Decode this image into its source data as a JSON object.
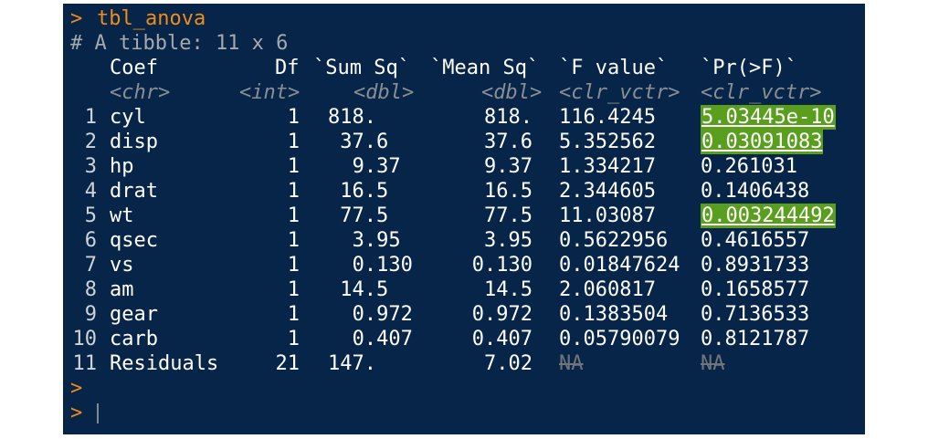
{
  "console": {
    "prompt_symbol": ">",
    "command": "tbl_anova",
    "tibble_header": "# A tibble: 11 x 6",
    "columns": [
      {
        "name": "Coef",
        "type": "<chr>"
      },
      {
        "name": "Df",
        "type": "<int>"
      },
      {
        "name": "`Sum Sq`",
        "type": "<dbl>"
      },
      {
        "name": "`Mean Sq`",
        "type": "<dbl>"
      },
      {
        "name": "`F value`",
        "type": "<clr_vctr>"
      },
      {
        "name": "`Pr(>F)`",
        "type": "<clr_vctr>"
      }
    ],
    "rows": [
      {
        "num": "1",
        "coef": "cyl",
        "df": "1",
        "sum_sq": "818.",
        "mean_sq": "818.",
        "f_value": "116.4245",
        "p_value": "5.03445e-10",
        "significant": true
      },
      {
        "num": "2",
        "coef": "disp",
        "df": "1",
        "sum_sq": "37.6",
        "mean_sq": "37.6",
        "f_value": "5.352562",
        "p_value": "0.03091083",
        "significant": true
      },
      {
        "num": "3",
        "coef": "hp",
        "df": "1",
        "sum_sq": "9.37",
        "mean_sq": "9.37",
        "f_value": "1.334217",
        "p_value": "0.261031",
        "significant": false
      },
      {
        "num": "4",
        "coef": "drat",
        "df": "1",
        "sum_sq": "16.5",
        "mean_sq": "16.5",
        "f_value": "2.344605",
        "p_value": "0.1406438",
        "significant": false
      },
      {
        "num": "5",
        "coef": "wt",
        "df": "1",
        "sum_sq": "77.5",
        "mean_sq": "77.5",
        "f_value": "11.03087",
        "p_value": "0.003244492",
        "significant": true
      },
      {
        "num": "6",
        "coef": "qsec",
        "df": "1",
        "sum_sq": "3.95",
        "mean_sq": "3.95",
        "f_value": "0.5622956",
        "p_value": "0.4616557",
        "significant": false
      },
      {
        "num": "7",
        "coef": "vs",
        "df": "1",
        "sum_sq": "0.130",
        "mean_sq": "0.130",
        "f_value": "0.01847624",
        "p_value": "0.8931733",
        "significant": false
      },
      {
        "num": "8",
        "coef": "am",
        "df": "1",
        "sum_sq": "14.5",
        "mean_sq": "14.5",
        "f_value": "2.060817",
        "p_value": "0.1658577",
        "significant": false
      },
      {
        "num": "9",
        "coef": "gear",
        "df": "1",
        "sum_sq": "0.972",
        "mean_sq": "0.972",
        "f_value": "0.1383504",
        "p_value": "0.7136533",
        "significant": false
      },
      {
        "num": "10",
        "coef": "carb",
        "df": "1",
        "sum_sq": "0.407",
        "mean_sq": "0.407",
        "f_value": "0.05790079",
        "p_value": "0.8121787",
        "significant": false
      },
      {
        "num": "11",
        "coef": "Residuals",
        "df": "21",
        "sum_sq": "147.",
        "mean_sq": "7.02",
        "f_value": "NA",
        "p_value": "NA",
        "significant": false,
        "missing": true
      }
    ],
    "colors": {
      "background": "#062548",
      "prompt": "#f08c18",
      "significant_highlight": "#5a9e1e"
    }
  }
}
